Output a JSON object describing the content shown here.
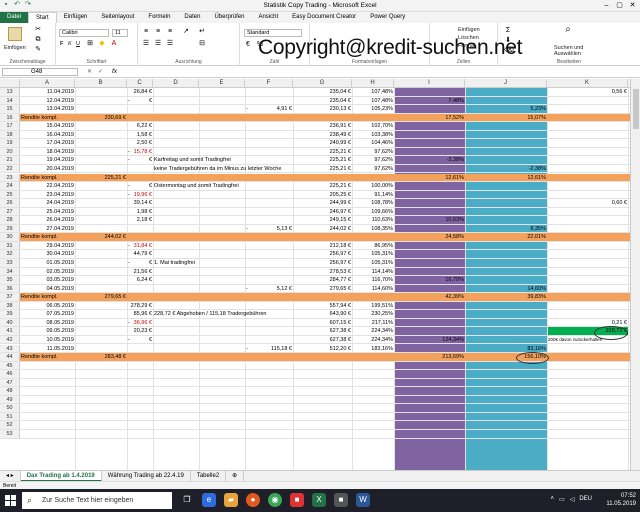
{
  "window": {
    "title": "Statistik Copy Trading  -  Microsoft Excel"
  },
  "quick_access": [
    "save-icon",
    "undo-icon",
    "redo-icon"
  ],
  "ribbon_tabs": [
    "Datei",
    "Start",
    "Einfügen",
    "Seitenlayout",
    "Formeln",
    "Daten",
    "Überprüfen",
    "Ansicht",
    "Easy Document Creator",
    "Power Query"
  ],
  "ribbon": {
    "paste_label": "Einfügen",
    "font_name": "Calibri",
    "font_size": "11",
    "number_format": "Standard",
    "insert_label": "Einfügen",
    "delete_label": "Löschen",
    "format_label": "Format",
    "find_label": "Suchen und Auswählen",
    "groups": [
      "Zwischenablage",
      "Schriftart",
      "Ausrichtung",
      "Zahl",
      "Formatvorlagen",
      "Zellen",
      "Bearbeiten"
    ]
  },
  "watermark": "Copyright@kredit-suchen.net",
  "formula_bar": {
    "name_box": "G48",
    "fx": "fx"
  },
  "columns": [
    "A",
    "B",
    "C",
    "D",
    "E",
    "F",
    "G",
    "H",
    "I",
    "J",
    "K"
  ],
  "rows": [
    {
      "n": "13",
      "a": "11.04.2019",
      "c": "26,84 €",
      "g": "235,04 €",
      "h": "107,48%",
      "k": "0,56 €"
    },
    {
      "n": "14",
      "a": "12.04.2019",
      "c0": "-",
      "c": "€",
      "g": "235,04 €",
      "h": "107,48%",
      "i": "7,48%"
    },
    {
      "n": "15",
      "a": "13.04.2019",
      "f0": "-",
      "f": "4,91 €",
      "g": "230,13 €",
      "h": "105,23%",
      "j": "5,23%"
    },
    {
      "n": "16",
      "rendite": true,
      "a": "Rendite kompl.",
      "b": "230,69 €",
      "i": "17,52%",
      "j": "15,07%"
    },
    {
      "n": "17",
      "a": "15.04.2019",
      "c": "6,22 €",
      "g": "236,91 €",
      "h": "102,70%"
    },
    {
      "n": "18",
      "a": "16.04.2019",
      "c": "1,58 €",
      "g": "238,49 €",
      "h": "103,38%"
    },
    {
      "n": "19",
      "a": "17.04.2019",
      "c": "2,50 €",
      "g": "240,99 €",
      "h": "104,46%"
    },
    {
      "n": "20",
      "a": "18.04.2019",
      "c0": "-",
      "c": "15,78 €",
      "cred": true,
      "g": "225,21 €",
      "h": "97,62%"
    },
    {
      "n": "21",
      "a": "19.04.2019",
      "c0": "-",
      "c": "€",
      "d": "Karfreitag und somit Tradingfrei",
      "g": "225,21 €",
      "h": "97,62%",
      "i": "-2,38%"
    },
    {
      "n": "22",
      "a": "20.04.2019",
      "d": "keine Tradergebühren da im Minus zu letzter Woche",
      "g": "225,21 €",
      "h": "97,62%",
      "j": "-2,38%"
    },
    {
      "n": "23",
      "rendite": true,
      "a": "Rendite kompl.",
      "b": "225,21 €",
      "i": "12,61%",
      "j": "12,61%"
    },
    {
      "n": "24",
      "a": "22.04.2019",
      "c0": "-",
      "c": "€",
      "d": "Ostermontag und somit Tradingfrei",
      "g": "225,21 €",
      "h": "100,00%"
    },
    {
      "n": "25",
      "a": "23.04.2019",
      "c0": "-",
      "c": "19,96 €",
      "cred": true,
      "g": "205,25 €",
      "h": "91,14%"
    },
    {
      "n": "26",
      "a": "24.04.2019",
      "c": "39,14 €",
      "g": "244,99 €",
      "h": "108,78%",
      "k": "0,60 €"
    },
    {
      "n": "27",
      "a": "25.04.2019",
      "c": "1,98 €",
      "g": "246,97 €",
      "h": "109,66%"
    },
    {
      "n": "28",
      "a": "26.04.2019",
      "c": "2,18 €",
      "g": "249,15 €",
      "h": "110,63%",
      "i": "10,63%"
    },
    {
      "n": "29",
      "a": "27.04.2019",
      "f0": "-",
      "f": "5,13 €",
      "g": "244,02 €",
      "h": "108,35%",
      "j": "8,35%"
    },
    {
      "n": "30",
      "rendite": true,
      "a": "Rendite kompl.",
      "b": "244,02 €",
      "i": "24,58%",
      "j": "22,01%"
    },
    {
      "n": "31",
      "a": "29.04.2019",
      "c0": "-",
      "c": "31,84 €",
      "cred": true,
      "g": "212,18 €",
      "h": "86,95%"
    },
    {
      "n": "32",
      "a": "30.04.2019",
      "c": "44,79 €",
      "g": "256,97 €",
      "h": "105,31%"
    },
    {
      "n": "33",
      "a": "01.05.2019",
      "c0": "-",
      "c": "€",
      "d": "1. Mai tradingfrei",
      "g": "256,97 €",
      "h": "105,31%"
    },
    {
      "n": "34",
      "a": "02.05.2019",
      "c": "21,56 €",
      "g": "278,53 €",
      "h": "114,14%"
    },
    {
      "n": "35",
      "a": "03.05.2019",
      "c": "6,24 €",
      "g": "284,77 €",
      "h": "116,70%",
      "i": "16,70%"
    },
    {
      "n": "36",
      "a": "04.05.2019",
      "f0": "-",
      "f": "5,12 €",
      "g": "279,65 €",
      "h": "114,60%",
      "j": "14,60%"
    },
    {
      "n": "37",
      "rendite": true,
      "a": "Rendite kompl.",
      "b": "279,65 €",
      "i": "42,39%",
      "j": "39,83%"
    },
    {
      "n": "38",
      "a": "06.05.2019",
      "c": "278,29 €",
      "g": "557,94 €",
      "h": "199,51%"
    },
    {
      "n": "39",
      "a": "07.05.2019",
      "c": "85,96 €",
      "d": "228,72 € Abgehoben / 115,18 Tradergebühren",
      "g": "643,90 €",
      "h": "230,25%"
    },
    {
      "n": "40",
      "a": "08.05.2019",
      "c0": "-",
      "c": "36,96 €",
      "cred": true,
      "g": "607,15 €",
      "h": "217,11%",
      "k": "0,21 €"
    },
    {
      "n": "41",
      "a": "09.05.2019",
      "c": "20,23 €",
      "g": "627,38 €",
      "h": "224,34%",
      "k": "228,72 €",
      "kgreen": true
    },
    {
      "n": "42",
      "a": "10.05.2019",
      "c0": "-",
      "c": "€",
      "g": "627,38 €",
      "h": "224,34%",
      "i": "124,34%",
      "k": "200€ davon zurückerhalten"
    },
    {
      "n": "43",
      "a": "11.05.2019",
      "f0": "-",
      "f": "115,18 €",
      "g": "512,20 €",
      "h": "183,16%",
      "j": "83,16%"
    },
    {
      "n": "44",
      "rendite": true,
      "a": "Rendite kompl.",
      "b": "283,48 €",
      "i": "213,69%",
      "j": "156,10%"
    },
    {
      "n": "45"
    },
    {
      "n": "46"
    },
    {
      "n": "47"
    },
    {
      "n": "48"
    },
    {
      "n": "49"
    },
    {
      "n": "50"
    },
    {
      "n": "51"
    },
    {
      "n": "52"
    },
    {
      "n": "53"
    }
  ],
  "sheet_tabs": [
    "Dax Trading ab 1.4.2019",
    "Währung Trading ab 22.4.19",
    "Tabelle2"
  ],
  "status": "Bereit",
  "colors": {
    "purple": "#8064a2",
    "teal": "#4bacc6",
    "orange": "#f4a15b",
    "green": "#00b050",
    "excel_green": "#217346"
  },
  "taskbar": {
    "search_placeholder": "Zur Suche Text hier eingeben",
    "lang": "DEU",
    "time": "07:52",
    "date": "11.05.2019"
  }
}
